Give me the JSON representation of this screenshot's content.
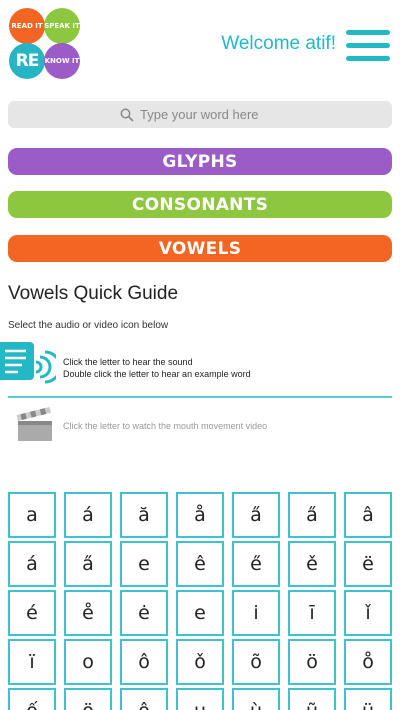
{
  "header": {
    "logo": {
      "q1": "READ IT",
      "q2": "SPEAK IT",
      "q3": "RE",
      "q4": "KNOW IT"
    },
    "welcome_text": "Welcome atif!",
    "menu_icon": "hamburger-icon"
  },
  "search": {
    "placeholder": "Type your word here",
    "icon": "search-icon"
  },
  "categories": [
    {
      "label": "GLYPHS",
      "color": "#9b5cc8"
    },
    {
      "label": "CONSONANTS",
      "color": "#8dc63f"
    },
    {
      "label": "VOWELS",
      "color": "#f26522"
    }
  ],
  "guide": {
    "title": "Vowels Quick Guide",
    "subtitle": "Select the audio or video icon below",
    "audio_line1": "Click the letter to hear the sound",
    "audio_line2": "Double click the letter to hear an example word",
    "video_text": "Click the letter to watch the mouth movement video"
  },
  "colors": {
    "accent": "#22b8c6",
    "cell_border": "#3fc2cf"
  },
  "vowels": [
    [
      "a",
      "á",
      "ă",
      "å",
      "a̋",
      "a̋",
      "â"
    ],
    [
      "á",
      "a̋",
      "e",
      "ê",
      "e̋",
      "ě",
      "ë"
    ],
    [
      "é",
      "e̊",
      "ė",
      "e",
      "i",
      "ī",
      "ǐ"
    ],
    [
      "ï",
      "o",
      "ô",
      "ǒ",
      "õ",
      "ö",
      "o̊"
    ],
    [
      "ố",
      "ö",
      "ô",
      "u",
      "ù",
      "ũ",
      "ü"
    ]
  ]
}
